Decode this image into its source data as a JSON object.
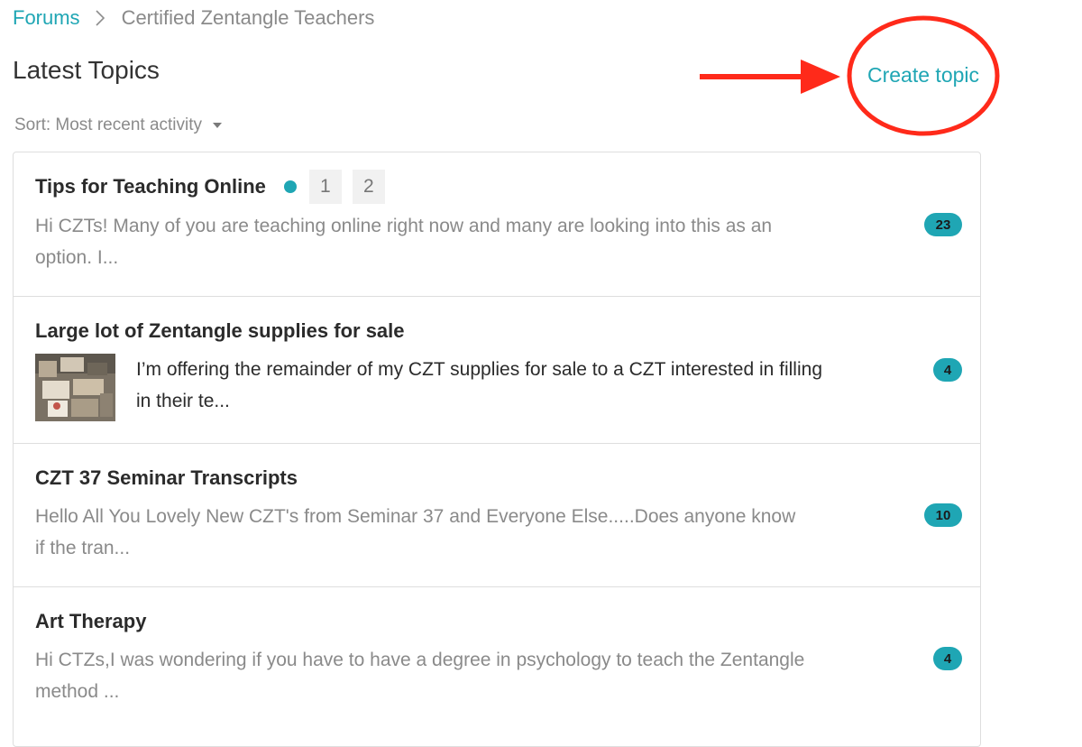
{
  "breadcrumb": {
    "root": "Forums",
    "current": "Certified Zentangle Teachers"
  },
  "page": {
    "title": "Latest Topics",
    "create_topic": "Create topic",
    "sort_label": "Sort: Most recent activity"
  },
  "topics": [
    {
      "title": "Tips for Teaching Online",
      "unread": true,
      "pages": [
        "1",
        "2"
      ],
      "excerpt_line1": "Hi CZTs! Many of you are teaching online right now and many are looking into this as an",
      "excerpt_line2": "option. I...",
      "replies": "23"
    },
    {
      "title": "Large lot of Zentangle supplies for sale",
      "has_thumbnail": true,
      "excerpt_line1": "I’m offering the remainder of my CZT supplies for sale to a CZT interested in filling",
      "excerpt_line2": "in their te...",
      "replies": "4"
    },
    {
      "title": "CZT 37 Seminar Transcripts",
      "excerpt_line1": "Hello All You Lovely New CZT's from Seminar 37 and Everyone Else.....Does anyone know",
      "excerpt_line2": "if the tran...",
      "replies": "10"
    },
    {
      "title": "Art Therapy",
      "excerpt_line1": "Hi CTZs,I was wondering if you have to have a degree in psychology to teach the Zentangle",
      "excerpt_line2": "method ...",
      "replies": "4"
    }
  ],
  "colors": {
    "accent": "#1fa6b4",
    "annotation": "#ff2a1a",
    "muted_text": "#8a8a8a",
    "border": "#dedede"
  },
  "icons": {
    "breadcrumb_separator": "chevron-right-icon",
    "sort_caret": "caret-down-icon",
    "unread": "unread-dot-icon",
    "annotation_arrow": "red-arrow-icon",
    "annotation_circle": "red-circle-highlight"
  }
}
